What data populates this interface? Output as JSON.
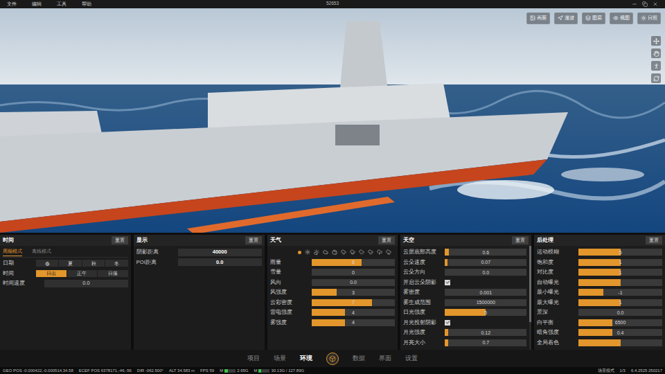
{
  "window": {
    "title": "52653"
  },
  "menu": [
    "文件",
    "编辑",
    "工具",
    "帮助"
  ],
  "viewport": {
    "toolbar": [
      {
        "label": "画面"
      },
      {
        "label": "漫游"
      },
      {
        "label": "图层"
      },
      {
        "label": "视图"
      },
      {
        "label": "日照"
      }
    ]
  },
  "panels": [
    {
      "title": "时间",
      "reset": "重置",
      "tabs": [
        {
          "label": "周期模式",
          "selected": true
        },
        {
          "label": "离线模式",
          "selected": false
        }
      ],
      "rows": [
        {
          "kind": "segments",
          "label": "日期",
          "options": [
            {
              "label": "春",
              "selected": false
            },
            {
              "label": "夏",
              "selected": false
            },
            {
              "label": "秋",
              "selected": false
            },
            {
              "label": "冬",
              "selected": false
            }
          ]
        },
        {
          "kind": "segments",
          "label": "时间",
          "options": [
            {
              "label": "日出",
              "selected": true
            },
            {
              "label": "正午",
              "selected": false
            },
            {
              "label": "日落",
              "selected": false
            }
          ]
        },
        {
          "kind": "field",
          "label": "时间速度",
          "value": "0.0",
          "highlighted": false
        }
      ]
    },
    {
      "title": "显示",
      "reset": "重置",
      "rows": [
        {
          "kind": "field",
          "label": "阴影距离",
          "value": "40000",
          "highlighted": true
        },
        {
          "kind": "field",
          "label": "POI距离",
          "value": "0.0",
          "highlighted": true
        }
      ]
    },
    {
      "title": "天气",
      "reset": "重置",
      "presets": [
        {
          "selected": true
        },
        {
          "selected": false
        },
        {
          "selected": false
        },
        {
          "selected": false
        },
        {
          "selected": false
        },
        {
          "selected": false
        },
        {
          "selected": false
        },
        {
          "selected": false
        },
        {
          "selected": false
        },
        {
          "selected": false
        },
        {
          "selected": false
        }
      ],
      "rows": [
        {
          "kind": "slider",
          "label": "雨量",
          "level": 0.6,
          "value": "6"
        },
        {
          "kind": "slider",
          "label": "雪量",
          "level": 0,
          "value": "0"
        },
        {
          "kind": "slider",
          "label": "风向",
          "level": 0,
          "value": "0.0"
        },
        {
          "kind": "slider",
          "label": "风强度",
          "level": 0.3,
          "value": "3"
        },
        {
          "kind": "slider",
          "label": "云彩密度",
          "level": 0.72,
          "value": "7"
        },
        {
          "kind": "slider",
          "label": "雷电强度",
          "level": 0.4,
          "value": "4"
        },
        {
          "kind": "slider",
          "label": "雾强度",
          "level": 0.4,
          "value": "4"
        }
      ]
    },
    {
      "title": "天空",
      "reset": "重置",
      "scrollbar": true,
      "rows": [
        {
          "kind": "slider",
          "label": "云层底部高度",
          "level": 0.05,
          "value": "0.6"
        },
        {
          "kind": "slider",
          "label": "云朵速度",
          "level": 0.03,
          "value": "0.07"
        },
        {
          "kind": "slider",
          "label": "云朵方向",
          "level": 0,
          "value": "0.0"
        },
        {
          "kind": "checkbox",
          "label": "开启云朵阴影",
          "checked": true
        },
        {
          "kind": "slider",
          "label": "雾密度",
          "level": 0,
          "value": "0.001"
        },
        {
          "kind": "slider",
          "label": "雾生成范围",
          "level": 0,
          "value": "1500000"
        },
        {
          "kind": "slider",
          "label": "日光强度",
          "level": 0.5,
          "value": "5"
        },
        {
          "kind": "checkbox",
          "label": "月光投射阴影",
          "checked": true
        },
        {
          "kind": "slider",
          "label": "月光强度",
          "level": 0.04,
          "value": "0.12"
        },
        {
          "kind": "slider",
          "label": "月亮大小",
          "level": 0.04,
          "value": "0.7"
        }
      ]
    },
    {
      "title": "后处理",
      "reset": "重置",
      "rows": [
        {
          "kind": "slider",
          "label": "运动模糊",
          "level": 0.5,
          "value": "5"
        },
        {
          "kind": "slider",
          "label": "饱和度",
          "level": 0.5,
          "value": "1"
        },
        {
          "kind": "slider",
          "label": "对比度",
          "level": 0.5,
          "value": "1"
        },
        {
          "kind": "slider",
          "label": "自动曝光",
          "level": 0.5,
          "value": ""
        },
        {
          "kind": "slider",
          "label": "最小曝光",
          "level": 0.3,
          "value": "-1"
        },
        {
          "kind": "slider",
          "label": "最大曝光",
          "level": 0.5,
          "value": "1"
        },
        {
          "kind": "slider",
          "label": "景深",
          "level": 0,
          "value": "0.0"
        },
        {
          "kind": "slider",
          "label": "白平衡",
          "level": 0.4,
          "value": "6500"
        },
        {
          "kind": "slider",
          "label": "暗角强度",
          "level": 0.4,
          "value": "0.4"
        },
        {
          "kind": "slider",
          "label": "全局着色",
          "level": 0.5,
          "value": ""
        }
      ]
    }
  ],
  "bottom_tabs": [
    {
      "label": "项目",
      "selected": false
    },
    {
      "label": "场景",
      "selected": false
    },
    {
      "label": "环境",
      "selected": true
    },
    {
      "label": "数据",
      "selected": false
    },
    {
      "label": "界面",
      "selected": false
    },
    {
      "label": "设置",
      "selected": false
    }
  ],
  "status_bar": {
    "fields": [
      {
        "label": "GEO POS",
        "value": "-0.000422,-0.000514,34.58"
      },
      {
        "label": "ECEF POS",
        "value": "6378171,-46,-56"
      },
      {
        "label": "DIR",
        "value": "-062.500°"
      },
      {
        "label": "ALT",
        "value": "34.583 m"
      },
      {
        "label": "FPS",
        "value": "59"
      }
    ],
    "meters": [
      {
        "label": "M",
        "level": 0.3,
        "value": "2.65G"
      },
      {
        "label": "M",
        "level": 0.25,
        "value": "30.13G / 127.89G"
      }
    ],
    "mode": "场景模式",
    "page": "1/3",
    "version": "6.4.2525 250217"
  }
}
